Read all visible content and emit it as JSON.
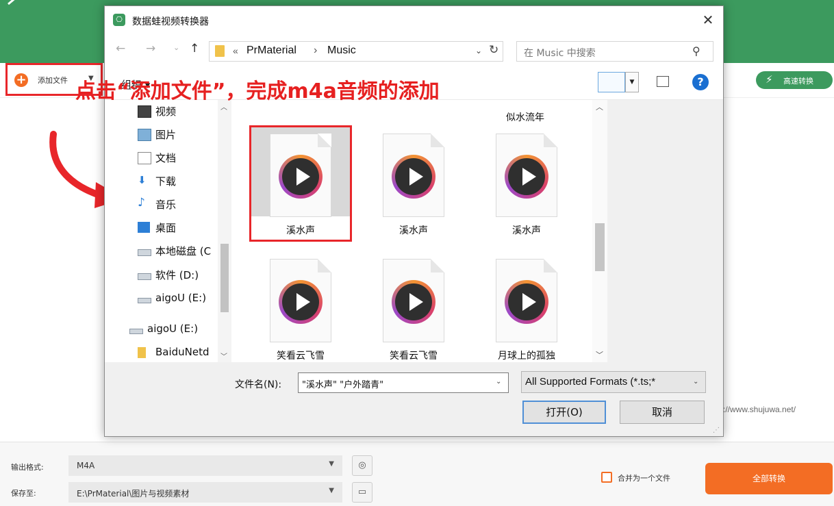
{
  "app": {
    "add_file_label": "添加文件",
    "fast_convert_label": "高速转换",
    "url": "s://www.shujuwa.net/",
    "output_format_label": "输出格式:",
    "output_format_value": "M4A",
    "save_to_label": "保存至:",
    "save_to_value": "E:\\PrMaterial\\图片与视频素材",
    "merge_label": "合并为一个文件",
    "convert_all_label": "全部转换",
    "accent_color": "#3c9a5e",
    "orange_color": "#f36d24"
  },
  "annotation": "点击“添加文件”，完成m4a音频的添加",
  "dialog": {
    "title": "数据蛙视频转换器",
    "address": {
      "chevron": "«",
      "crumbs": [
        "PrMaterial",
        "Music"
      ],
      "separator": "›"
    },
    "search_placeholder": "在 Music 中搜索",
    "organize_label": "组织 ▾",
    "nav_items": [
      {
        "label": "视频",
        "icon": "video-icon"
      },
      {
        "label": "图片",
        "icon": "picture-icon"
      },
      {
        "label": "文档",
        "icon": "document-icon"
      },
      {
        "label": "下载",
        "icon": "download-icon"
      },
      {
        "label": "音乐",
        "icon": "music-icon"
      },
      {
        "label": "桌面",
        "icon": "desktop-icon"
      },
      {
        "label": "本地磁盘 (C",
        "icon": "drive-icon"
      },
      {
        "label": "软件 (D:)",
        "icon": "drive-icon"
      },
      {
        "label": "aigoU (E:)",
        "icon": "usb-drive-icon"
      },
      {
        "label": "aigoU (E:)",
        "icon": "usb-drive-icon"
      },
      {
        "label": "BaiduNetd",
        "icon": "folder-icon"
      }
    ],
    "partial_top_label": "似水流年",
    "files": [
      {
        "name": "溪水声",
        "selected": true
      },
      {
        "name": "溪水声",
        "selected": false
      },
      {
        "name": "溪水声",
        "selected": false
      },
      {
        "name": "笑看云飞雪",
        "selected": false
      },
      {
        "name": "笑看云飞雪",
        "selected": false
      },
      {
        "name": "月球上的孤独",
        "selected": false
      }
    ],
    "filename_label": "文件名(N):",
    "filename_value": "\"溪水声\" \"户外踏青\"",
    "format_value": "All Supported Formats (*.ts;*",
    "open_label": "打开(O)",
    "cancel_label": "取消"
  }
}
